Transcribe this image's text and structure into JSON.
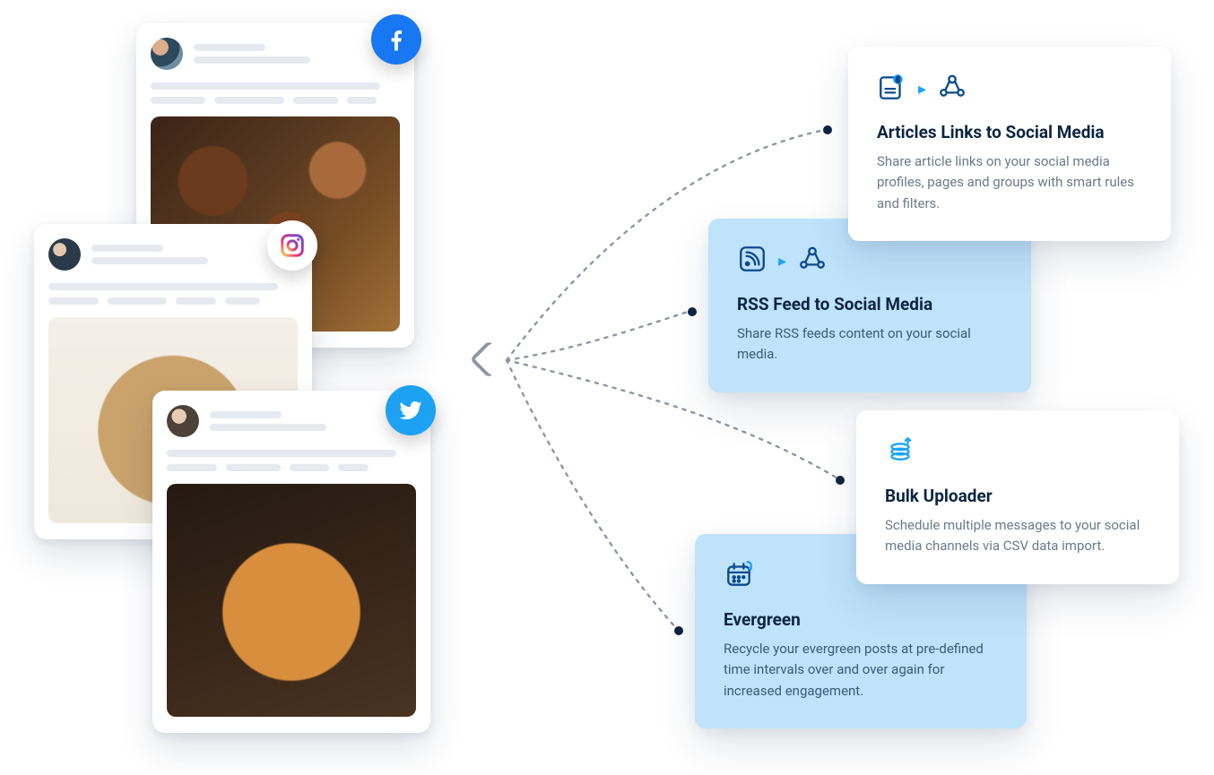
{
  "features": {
    "articles": {
      "title": "Articles Links to Social Media",
      "desc": "Share article links on your social media profiles, pages and groups with smart rules and filters."
    },
    "rss": {
      "title": "RSS Feed to Social Media",
      "desc": "Share RSS feeds content on your social media."
    },
    "bulk": {
      "title": "Bulk Uploader",
      "desc": "Schedule multiple messages to your social media channels via CSV data import."
    },
    "evergreen": {
      "title": "Evergreen",
      "desc": "Recycle your evergreen posts at pre-defined time intervals over and over again for increased engagement."
    }
  },
  "posts": {
    "facebook": "Facebook",
    "instagram": "Instagram",
    "twitter": "Twitter"
  }
}
